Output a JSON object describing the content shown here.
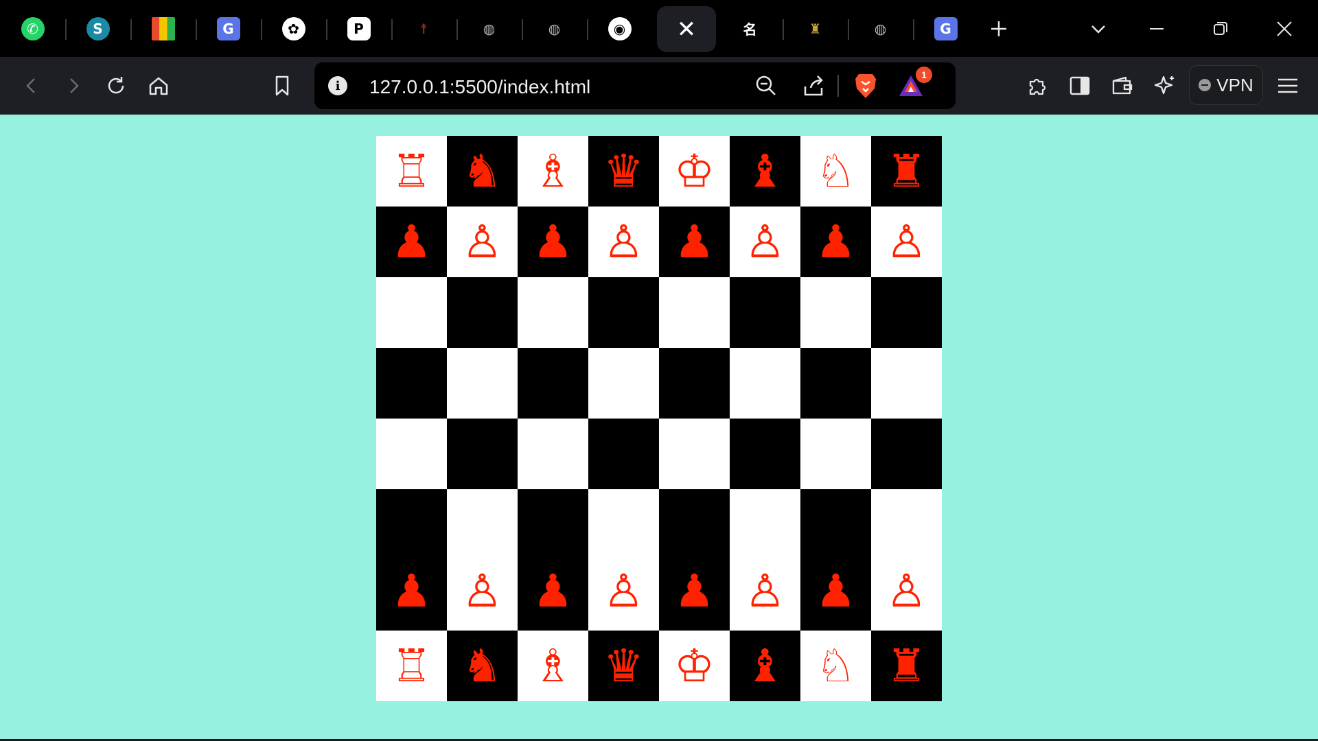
{
  "browser": {
    "active_tab_close": "✕",
    "new_tab": "+",
    "tab_list": "⌄",
    "tabs": [
      {
        "icon": "whatsapp-icon",
        "glyph": "✆",
        "color": "#25d366"
      },
      {
        "icon": "swift-sync-icon",
        "glyph": "S",
        "color": "#1a8aa5"
      },
      {
        "icon": "palette-icon",
        "glyph": "",
        "color": "#e84a2d"
      },
      {
        "icon": "translate-icon",
        "glyph": "G",
        "color": "#5b74e8"
      },
      {
        "icon": "openai-icon",
        "glyph": "✿",
        "color": "#ffffff"
      },
      {
        "icon": "pinterest-p-icon",
        "glyph": "P",
        "color": "#ffffff"
      },
      {
        "icon": "figure-icon",
        "glyph": "☨",
        "color": "#b7301c"
      },
      {
        "icon": "globe-icon",
        "glyph": "◍",
        "color": "#b8b8b8"
      },
      {
        "icon": "globe-icon",
        "glyph": "◍",
        "color": "#b8b8b8"
      },
      {
        "icon": "github-icon",
        "glyph": "◉",
        "color": "#ffffff"
      },
      {
        "icon": "close-icon",
        "glyph": "✕",
        "color": "#ffffff"
      },
      {
        "icon": "name-icon",
        "glyph": "名",
        "color": "#ffffff"
      },
      {
        "icon": "trophy-icon",
        "glyph": "♜",
        "color": "#c9a33a"
      },
      {
        "icon": "globe-icon",
        "glyph": "◍",
        "color": "#b8b8b8"
      },
      {
        "icon": "translate-icon",
        "glyph": "G",
        "color": "#5b74e8"
      }
    ]
  },
  "toolbar": {
    "url": "127.0.0.1:5500/index.html",
    "info_glyph": "i",
    "notification_count": "1",
    "vpn_label": "VPN"
  },
  "page": {
    "background": "#97f1e1",
    "piece_color": "#ff2200",
    "light_square": "#ffffff",
    "dark_square": "#000000",
    "board": [
      [
        "♖",
        "♞",
        "♗",
        "♛",
        "♔",
        "♝",
        "♘",
        "♜"
      ],
      [
        "♟",
        "♙",
        "♟",
        "♙",
        "♟",
        "♙",
        "♟",
        "♙"
      ],
      [
        "",
        "",
        "",
        "",
        "",
        "",
        "",
        ""
      ],
      [
        "",
        "",
        "",
        "",
        "",
        "",
        "",
        ""
      ],
      [
        "",
        "",
        "",
        "",
        "",
        "",
        "",
        ""
      ],
      [
        "♟",
        "♙",
        "♟",
        "♙",
        "♟",
        "♙",
        "♟",
        "♙"
      ],
      [
        "♖",
        "♞",
        "♗",
        "♛",
        "♔",
        "♝",
        "♘",
        "♜"
      ]
    ]
  }
}
